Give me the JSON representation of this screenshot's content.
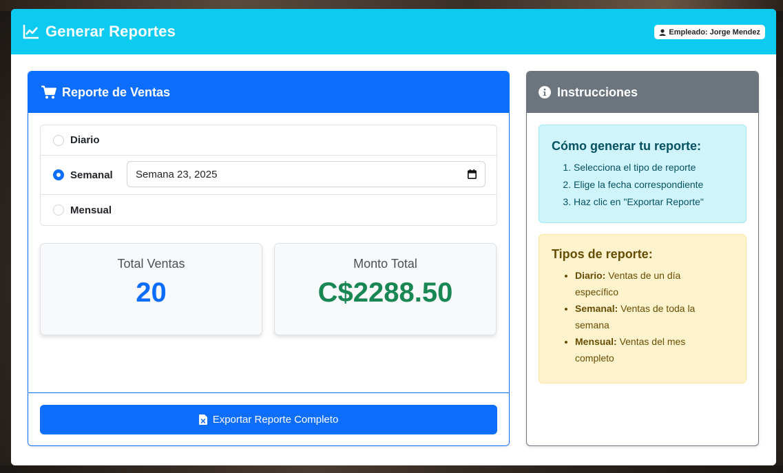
{
  "app": {
    "title": "Generar Reportes",
    "employee_badge": "Empleado: Jorge Mendez"
  },
  "sales_report": {
    "header": "Reporte de Ventas",
    "options": [
      {
        "label": "Diario",
        "selected": false
      },
      {
        "label": "Semanal",
        "selected": true
      },
      {
        "label": "Mensual",
        "selected": false
      }
    ],
    "week_value": "Semana 23, 2025",
    "stats": {
      "total_sales_label": "Total Ventas",
      "total_sales_value": "20",
      "total_amount_label": "Monto Total",
      "total_amount_value": "C$2288.50"
    },
    "export_button": "Exportar Reporte Completo"
  },
  "instructions": {
    "header": "Instrucciones",
    "how_to": {
      "title": "Cómo generar tu reporte:",
      "steps": [
        "Selecciona el tipo de reporte",
        "Elige la fecha correspondiente",
        "Haz clic en \"Exportar Reporte\""
      ]
    },
    "types": {
      "title": "Tipos de reporte:",
      "items": [
        {
          "name": "Diario:",
          "desc": " Ventas de un día específico"
        },
        {
          "name": "Semanal:",
          "desc": " Ventas de toda la semana"
        },
        {
          "name": "Mensual:",
          "desc": " Ventas del mes completo"
        }
      ]
    }
  },
  "colors": {
    "topbar": "#0dcaf0",
    "primary": "#0d6efd",
    "secondary": "#6c757d",
    "success": "#198754"
  },
  "icons": [
    "chart-line-icon",
    "user-icon",
    "cart-icon",
    "calendar-icon",
    "excel-file-icon",
    "info-icon"
  ]
}
